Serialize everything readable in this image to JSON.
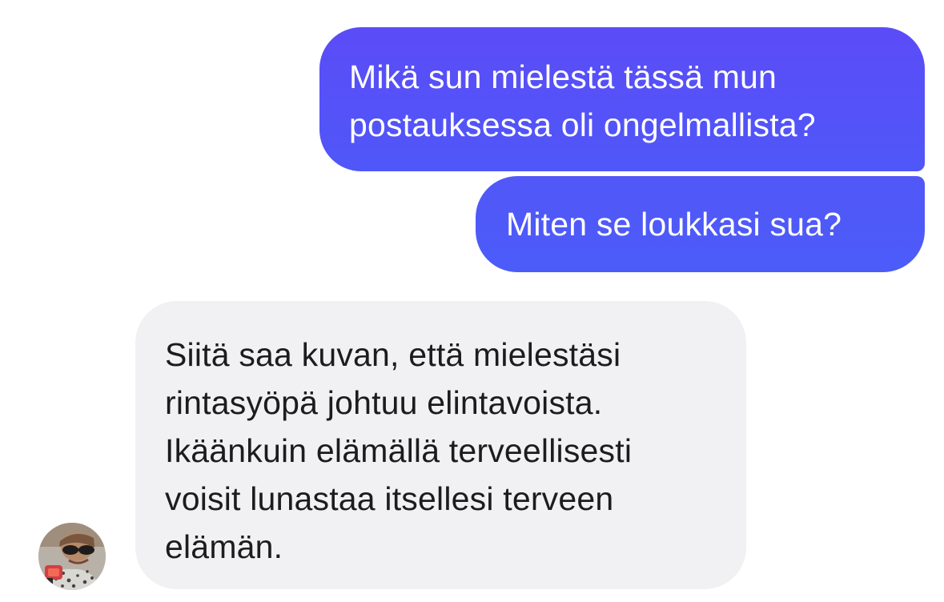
{
  "conversation": {
    "messages": [
      {
        "direction": "outgoing",
        "text": "Mikä sun mielestä tässä mun\npostauksessa oli ongelmallista?"
      },
      {
        "direction": "outgoing",
        "text": "Miten se loukkasi sua?"
      },
      {
        "direction": "incoming",
        "text": "Siitä saa kuvan, että mielestäsi\nrintasyöpä johtuu elintavoista.\nIkäänkuin elämällä terveellisesti\nvoisit lunastaa itsellesi terveen\nelämän."
      }
    ],
    "avatar": {
      "icon": "user-avatar-photo"
    }
  },
  "colors": {
    "outgoing_bubble": "#5456f8",
    "incoming_bubble": "#f1f1f3",
    "outgoing_text": "#ffffff",
    "incoming_text": "#1c1c1e"
  }
}
